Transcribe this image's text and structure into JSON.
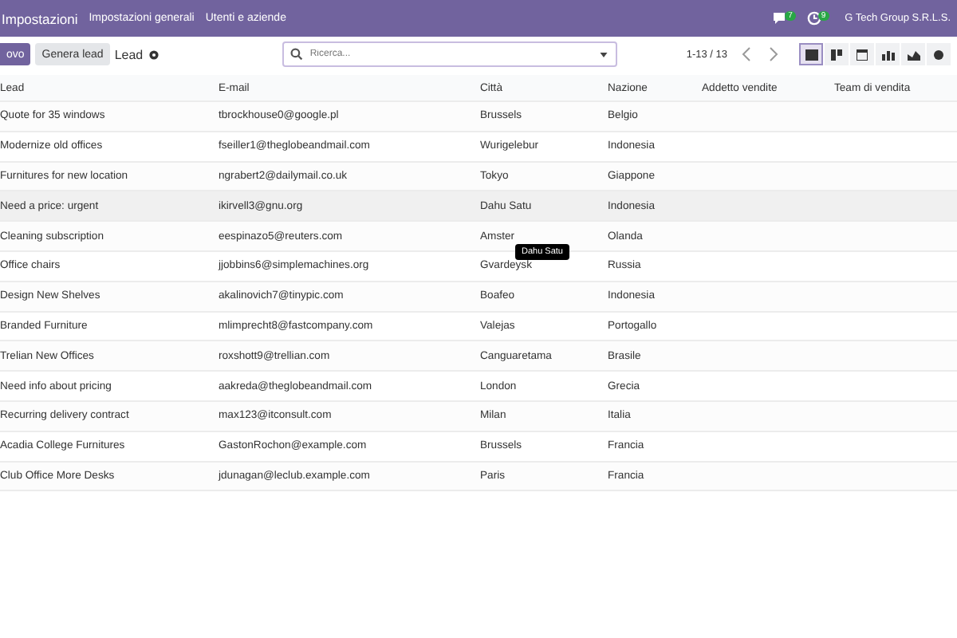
{
  "navbar": {
    "app": "Impostazioni",
    "menu": [
      "Impostazioni generali",
      "Utenti e aziende"
    ],
    "messages_badge": "7",
    "activity_badge": "9",
    "company": "G Tech Group S.R.L.S."
  },
  "control_panel": {
    "new_button": "ovo",
    "generate_button": "Genera lead",
    "breadcrumb": "Lead",
    "search": {
      "placeholder": "Ricerca..."
    },
    "pager": "1-13 / 13",
    "views": [
      {
        "kind": "list",
        "selected": true
      },
      {
        "kind": "kanban",
        "selected": false
      },
      {
        "kind": "calendar",
        "selected": false
      },
      {
        "kind": "pivot",
        "selected": false
      },
      {
        "kind": "graph",
        "selected": false
      },
      {
        "kind": "activity",
        "selected": false
      }
    ]
  },
  "table": {
    "columns": [
      "Lead",
      "E-mail",
      "Città",
      "Nazione",
      "Addetto vendite",
      "Team di vendita"
    ],
    "rows": [
      {
        "cells": [
          "Quote for 35 windows",
          "tbrockhouse0@google.pl",
          "Brussels",
          "Belgio"
        ],
        "hovered": false
      },
      {
        "cells": [
          "Modernize old offices",
          "fseiller1@theglobeandmail.com",
          "Wurigelebur",
          "Indonesia"
        ],
        "hovered": false
      },
      {
        "cells": [
          "Furnitures for new location",
          "ngrabert2@dailymail.co.uk",
          "Tokyo",
          "Giappone"
        ],
        "hovered": false
      },
      {
        "cells": [
          "Need a price: urgent",
          "ikirvell3@gnu.org",
          "Dahu Satu",
          "Indonesia"
        ],
        "hovered": true
      },
      {
        "cells": [
          "Cleaning subscription",
          "eespinazo5@reuters.com",
          "Amster",
          "Olanda"
        ],
        "hovered": false,
        "tooltip": "Dahu Satu"
      },
      {
        "cells": [
          "Office chairs",
          "jjobbins6@simplemachines.org",
          "Gvardeysk",
          "Russia"
        ],
        "hovered": false
      },
      {
        "cells": [
          "Design New Shelves",
          "akalinovich7@tinypic.com",
          "Boafeo",
          "Indonesia"
        ],
        "hovered": false
      },
      {
        "cells": [
          "Branded Furniture",
          "mlimprecht8@fastcompany.com",
          "Valejas",
          "Portogallo"
        ],
        "hovered": false
      },
      {
        "cells": [
          "Trelian New Offices",
          "roxshott9@trellian.com",
          "Canguaretama",
          "Brasile"
        ],
        "hovered": false
      },
      {
        "cells": [
          "Need info about pricing",
          "aakreda@theglobeandmail.com",
          "London",
          "Grecia"
        ],
        "hovered": false
      },
      {
        "cells": [
          "Recurring delivery contract",
          "max123@itconsult.com",
          "Milan",
          "Italia"
        ],
        "hovered": false
      },
      {
        "cells": [
          "Acadia College Furnitures",
          "GastonRochon@example.com",
          "Brussels",
          "Francia"
        ],
        "hovered": false
      },
      {
        "cells": [
          "Club Office More Desks",
          "jdunagan@leclub.example.com",
          "Paris",
          "Francia"
        ],
        "hovered": false
      }
    ]
  }
}
